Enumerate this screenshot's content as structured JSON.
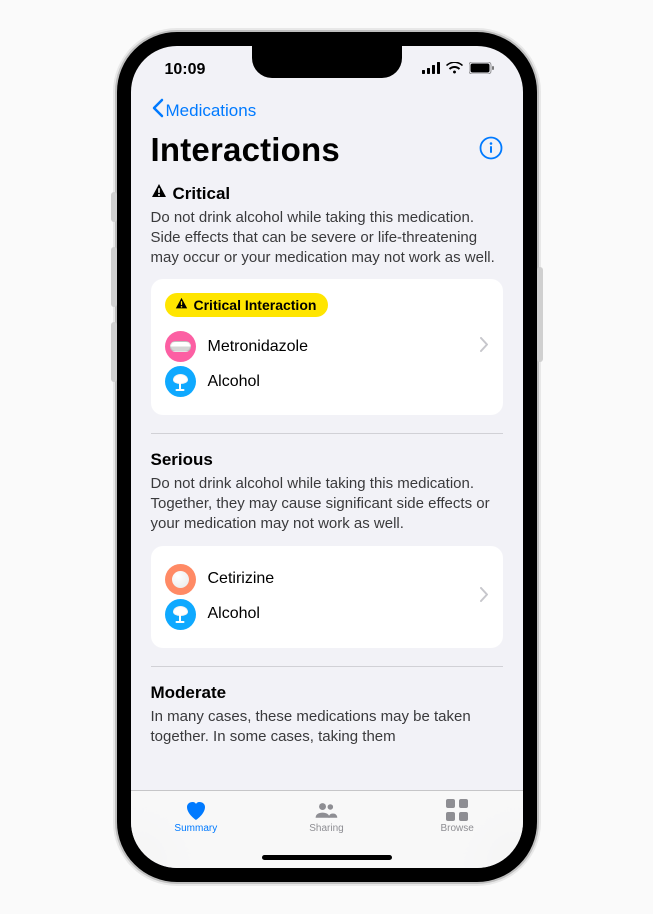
{
  "status": {
    "time": "10:09"
  },
  "nav": {
    "back_label": "Medications"
  },
  "header": {
    "title": "Interactions"
  },
  "sections": {
    "critical": {
      "heading": "Critical",
      "description": "Do not drink alcohol while taking this medication. Side effects that can be severe or life-threatening may occur or your medication may not work as well.",
      "badge": "Critical Interaction",
      "items": {
        "0": "Metronidazole",
        "1": "Alcohol"
      }
    },
    "serious": {
      "heading": "Serious",
      "description": "Do not drink alcohol while taking this medication. Together, they may cause significant side effects or your medication may not work as well.",
      "items": {
        "0": "Cetirizine",
        "1": "Alcohol"
      }
    },
    "moderate": {
      "heading": "Moderate",
      "description": "In many cases, these medications may be taken together. In some cases, taking them"
    }
  },
  "tabs": {
    "summary": "Summary",
    "sharing": "Sharing",
    "browse": "Browse"
  }
}
